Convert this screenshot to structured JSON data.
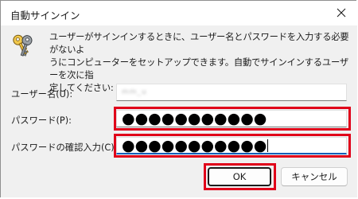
{
  "window": {
    "title": "自動サインイン",
    "close_icon": "close-icon"
  },
  "description": {
    "icon": "keys-icon",
    "line1": "ユーザーがサインインするときに、ユーザー名とパスワードを入力する必要がないよ",
    "line2": "うにコンピューターをセットアップできます。自動でサインインするユーザーを次に指",
    "line3": "定してください:"
  },
  "form": {
    "username": {
      "label": "ユーザー名(U):",
      "value": "mm_u"
    },
    "password": {
      "label": "パスワード(P):",
      "value": "●●●●●●●●●●●"
    },
    "confirm_password": {
      "label": "パスワードの確認入力(C):",
      "value": "●●●●●●●●●●●"
    }
  },
  "buttons": {
    "ok_label": "OK",
    "cancel_label": "キャンセル"
  },
  "colors": {
    "highlight": "#e0001a",
    "focus_accent": "#005fb8"
  }
}
